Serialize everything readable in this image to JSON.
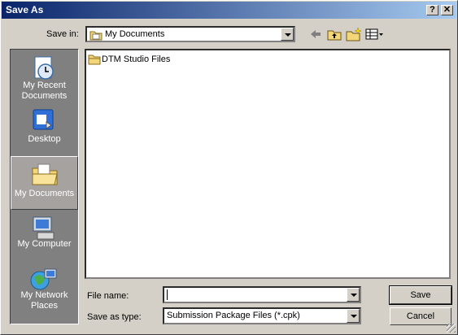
{
  "window": {
    "title": "Save As",
    "help_label": "?",
    "close_label": "✕"
  },
  "toolbar": {
    "save_in_label": "Save in:",
    "location_value": "My Documents",
    "back_icon": "back-arrow-icon",
    "up_icon": "up-one-level-icon",
    "new_folder_icon": "new-folder-icon",
    "views_icon": "views-menu-icon"
  },
  "places": [
    {
      "label": "My Recent Documents",
      "icon": "recent-documents-icon",
      "selected": false
    },
    {
      "label": "Desktop",
      "icon": "desktop-icon",
      "selected": false
    },
    {
      "label": "My Documents",
      "icon": "my-documents-icon",
      "selected": true
    },
    {
      "label": "My Computer",
      "icon": "my-computer-icon",
      "selected": false
    },
    {
      "label": "My Network Places",
      "icon": "network-places-icon",
      "selected": false
    }
  ],
  "files": [
    {
      "name": "DTM Studio Files",
      "icon": "folder-icon"
    }
  ],
  "form": {
    "file_name_label": "File name:",
    "file_name_value": "",
    "save_as_type_label": "Save as type:",
    "save_as_type_value": "Submission Package Files (*.cpk)"
  },
  "buttons": {
    "save": "Save",
    "cancel": "Cancel"
  },
  "colors": {
    "title_start": "#0a246a",
    "title_end": "#a6caf0",
    "face": "#d4d0c8",
    "places_bg": "#808080"
  }
}
